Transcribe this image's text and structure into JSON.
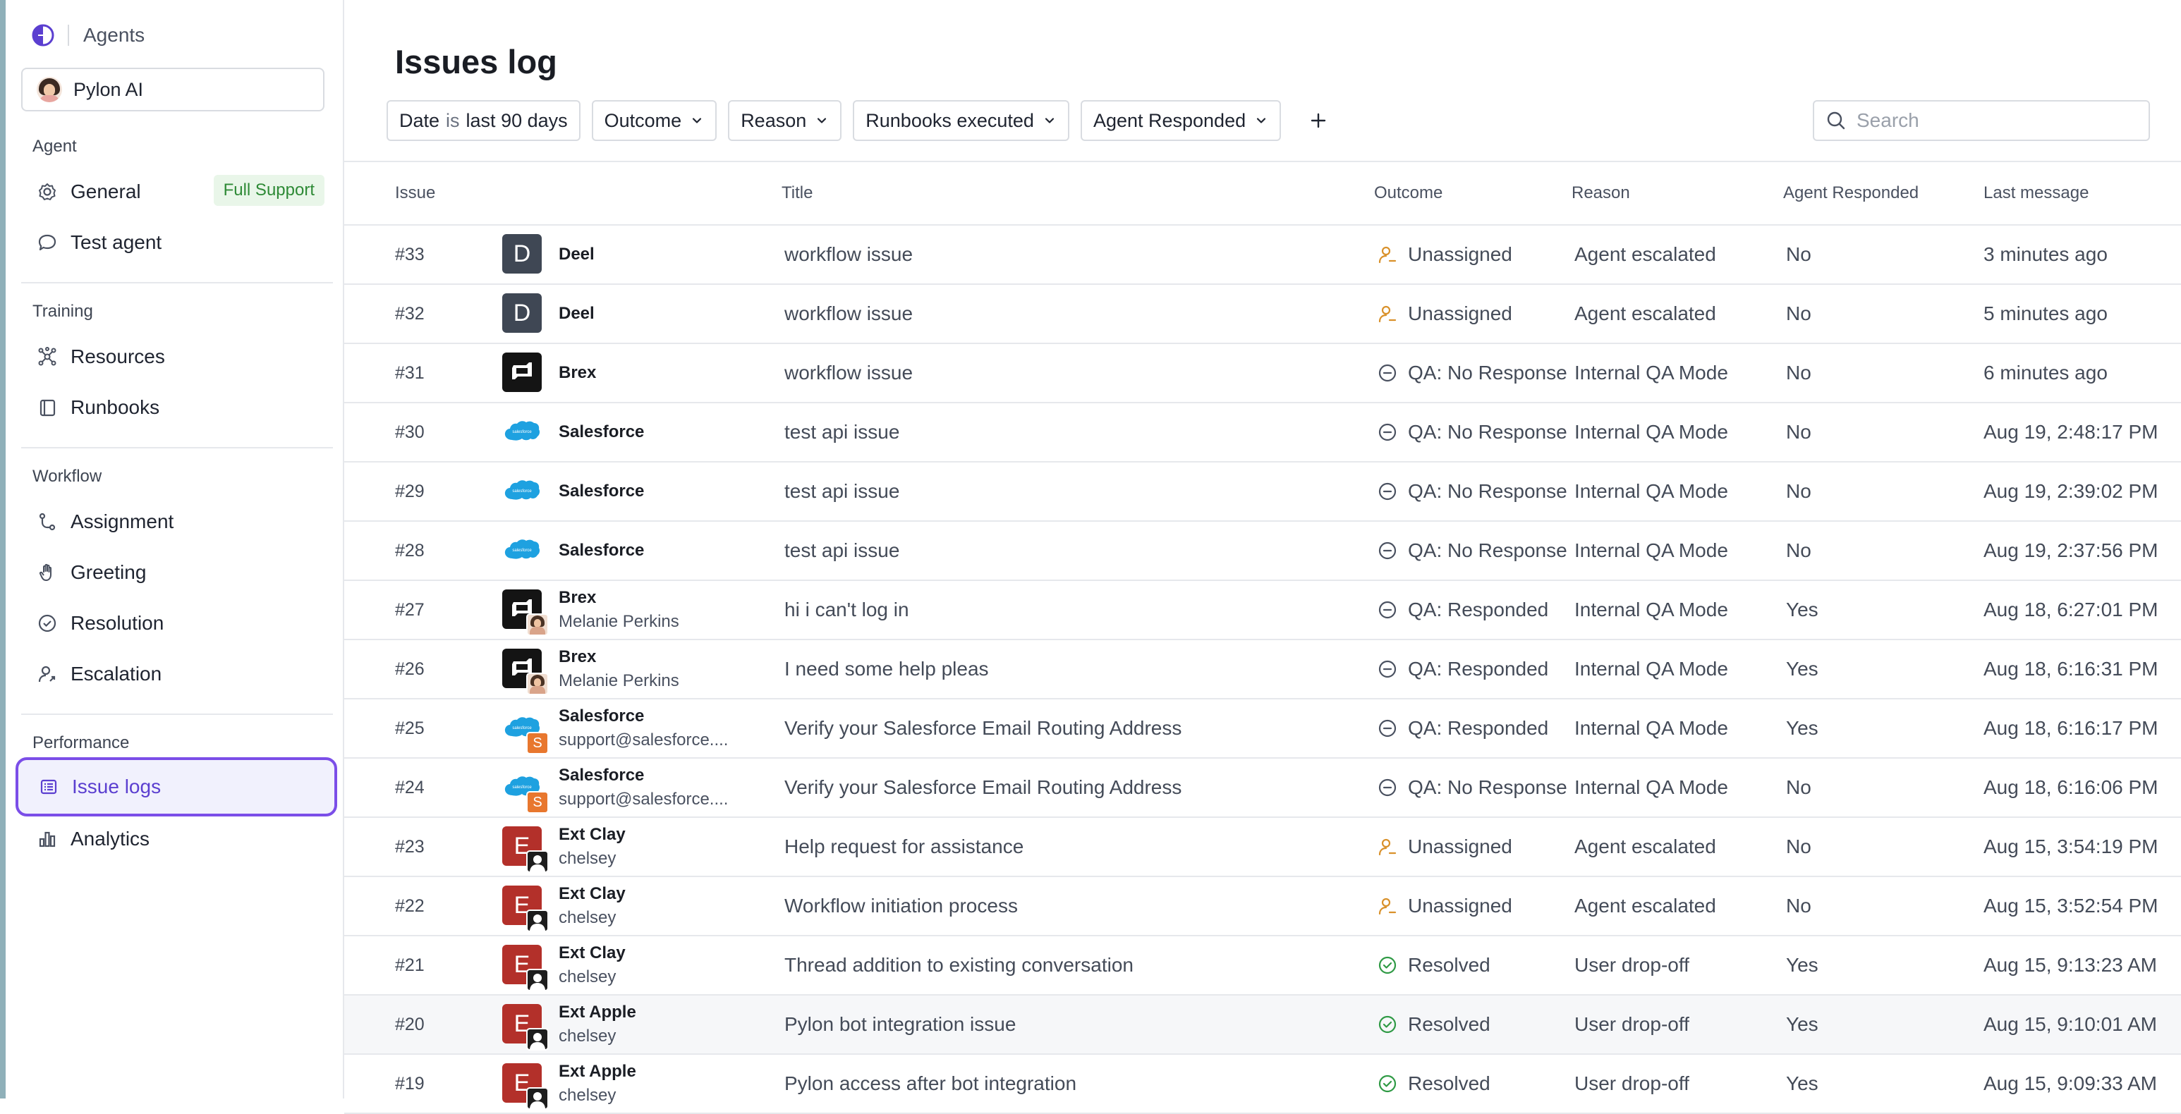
{
  "brand": {
    "name": "Agents"
  },
  "agent_select": {
    "name": "Pylon AI"
  },
  "sidebar": {
    "sections": {
      "agent": "Agent",
      "training": "Training",
      "workflow": "Workflow",
      "performance": "Performance"
    },
    "items": {
      "general": {
        "label": "General",
        "badge": "Full Support",
        "icon": "gear-icon"
      },
      "test_agent": {
        "label": "Test agent",
        "icon": "chat-bubble-icon"
      },
      "resources": {
        "label": "Resources",
        "icon": "network-icon"
      },
      "runbooks": {
        "label": "Runbooks",
        "icon": "book-icon"
      },
      "assignment": {
        "label": "Assignment",
        "icon": "route-icon"
      },
      "greeting": {
        "label": "Greeting",
        "icon": "hand-icon"
      },
      "resolution": {
        "label": "Resolution",
        "icon": "check-circle-icon"
      },
      "escalation": {
        "label": "Escalation",
        "icon": "user-escalate-icon"
      },
      "issue_logs": {
        "label": "Issue logs",
        "icon": "list-icon",
        "active": true
      },
      "analytics": {
        "label": "Analytics",
        "icon": "bar-chart-icon"
      }
    }
  },
  "page": {
    "title": "Issues log"
  },
  "filters": {
    "date": {
      "field": "Date",
      "op": "is",
      "value": "last 90 days"
    },
    "outcome": "Outcome",
    "reason": "Reason",
    "runbooks": "Runbooks executed",
    "agent_responded": "Agent Responded"
  },
  "search": {
    "placeholder": "Search"
  },
  "columns": {
    "issue": "Issue",
    "title": "Title",
    "outcome": "Outcome",
    "reason": "Reason",
    "agent_responded": "Agent Responded",
    "last_message": "Last message"
  },
  "rows": [
    {
      "issue": "#33",
      "org": "Deel",
      "user": "",
      "logo": "deel",
      "logo_letter": "D",
      "sub": "",
      "title": "workflow issue",
      "outcome": "Unassigned",
      "outcome_icon": "unassigned",
      "reason": "Agent escalated",
      "responded": "No",
      "last": "3 minutes ago"
    },
    {
      "issue": "#32",
      "org": "Deel",
      "user": "",
      "logo": "deel",
      "logo_letter": "D",
      "sub": "",
      "title": "workflow issue",
      "outcome": "Unassigned",
      "outcome_icon": "unassigned",
      "reason": "Agent escalated",
      "responded": "No",
      "last": "5 minutes ago"
    },
    {
      "issue": "#31",
      "org": "Brex",
      "user": "",
      "logo": "brex",
      "logo_letter": "",
      "sub": "",
      "title": "workflow issue",
      "outcome": "QA: No Response",
      "outcome_icon": "qa",
      "reason": "Internal QA Mode",
      "responded": "No",
      "last": "6 minutes ago"
    },
    {
      "issue": "#30",
      "org": "Salesforce",
      "user": "",
      "logo": "salesforce",
      "logo_letter": "",
      "sub": "",
      "title": "test api issue",
      "outcome": "QA: No Response",
      "outcome_icon": "qa",
      "reason": "Internal QA Mode",
      "responded": "No",
      "last": "Aug 19, 2:48:17 PM"
    },
    {
      "issue": "#29",
      "org": "Salesforce",
      "user": "",
      "logo": "salesforce",
      "logo_letter": "",
      "sub": "",
      "title": "test api issue",
      "outcome": "QA: No Response",
      "outcome_icon": "qa",
      "reason": "Internal QA Mode",
      "responded": "No",
      "last": "Aug 19, 2:39:02 PM"
    },
    {
      "issue": "#28",
      "org": "Salesforce",
      "user": "",
      "logo": "salesforce",
      "logo_letter": "",
      "sub": "",
      "title": "test api issue",
      "outcome": "QA: No Response",
      "outcome_icon": "qa",
      "reason": "Internal QA Mode",
      "responded": "No",
      "last": "Aug 19, 2:37:56 PM"
    },
    {
      "issue": "#27",
      "org": "Brex",
      "user": "Melanie Perkins",
      "logo": "brex",
      "logo_letter": "",
      "sub": "photo",
      "title": "hi i can't log in",
      "outcome": "QA: Responded",
      "outcome_icon": "qa",
      "reason": "Internal QA Mode",
      "responded": "Yes",
      "last": "Aug 18, 6:27:01 PM"
    },
    {
      "issue": "#26",
      "org": "Brex",
      "user": "Melanie Perkins",
      "logo": "brex",
      "logo_letter": "",
      "sub": "photo",
      "title": "I need some help pleas",
      "outcome": "QA: Responded",
      "outcome_icon": "qa",
      "reason": "Internal QA Mode",
      "responded": "Yes",
      "last": "Aug 18, 6:16:31 PM"
    },
    {
      "issue": "#25",
      "org": "Salesforce",
      "user": "support@salesforce....",
      "logo": "salesforce",
      "logo_letter": "",
      "sub": "S",
      "title": "Verify your Salesforce Email Routing Address",
      "outcome": "QA: Responded",
      "outcome_icon": "qa",
      "reason": "Internal QA Mode",
      "responded": "Yes",
      "last": "Aug 18, 6:16:17 PM"
    },
    {
      "issue": "#24",
      "org": "Salesforce",
      "user": "support@salesforce....",
      "logo": "salesforce",
      "logo_letter": "",
      "sub": "S",
      "title": "Verify your Salesforce Email Routing Address",
      "outcome": "QA: No Response",
      "outcome_icon": "qa",
      "reason": "Internal QA Mode",
      "responded": "No",
      "last": "Aug 18, 6:16:06 PM"
    },
    {
      "issue": "#23",
      "org": "Ext Clay",
      "user": "chelsey",
      "logo": "ext",
      "logo_letter": "E",
      "sub": "user",
      "title": "Help request for assistance",
      "outcome": "Unassigned",
      "outcome_icon": "unassigned",
      "reason": "Agent escalated",
      "responded": "No",
      "last": "Aug 15, 3:54:19 PM"
    },
    {
      "issue": "#22",
      "org": "Ext Clay",
      "user": "chelsey",
      "logo": "ext",
      "logo_letter": "E",
      "sub": "user",
      "title": "Workflow initiation process",
      "outcome": "Unassigned",
      "outcome_icon": "unassigned",
      "reason": "Agent escalated",
      "responded": "No",
      "last": "Aug 15, 3:52:54 PM"
    },
    {
      "issue": "#21",
      "org": "Ext Clay",
      "user": "chelsey",
      "logo": "ext",
      "logo_letter": "E",
      "sub": "user",
      "title": "Thread addition to existing conversation",
      "outcome": "Resolved",
      "outcome_icon": "resolved",
      "reason": "User drop-off",
      "responded": "Yes",
      "last": "Aug 15, 9:13:23 AM"
    },
    {
      "issue": "#20",
      "org": "Ext Apple",
      "user": "chelsey",
      "logo": "ext",
      "logo_letter": "E",
      "sub": "user",
      "title": "Pylon bot integration issue",
      "outcome": "Resolved",
      "outcome_icon": "resolved",
      "reason": "User drop-off",
      "responded": "Yes",
      "last": "Aug 15, 9:10:01 AM",
      "highlight": true
    },
    {
      "issue": "#19",
      "org": "Ext Apple",
      "user": "chelsey",
      "logo": "ext",
      "logo_letter": "E",
      "sub": "user",
      "title": "Pylon access after bot integration",
      "outcome": "Resolved",
      "outcome_icon": "resolved",
      "reason": "User drop-off",
      "responded": "Yes",
      "last": "Aug 15, 9:09:33 AM"
    }
  ]
}
